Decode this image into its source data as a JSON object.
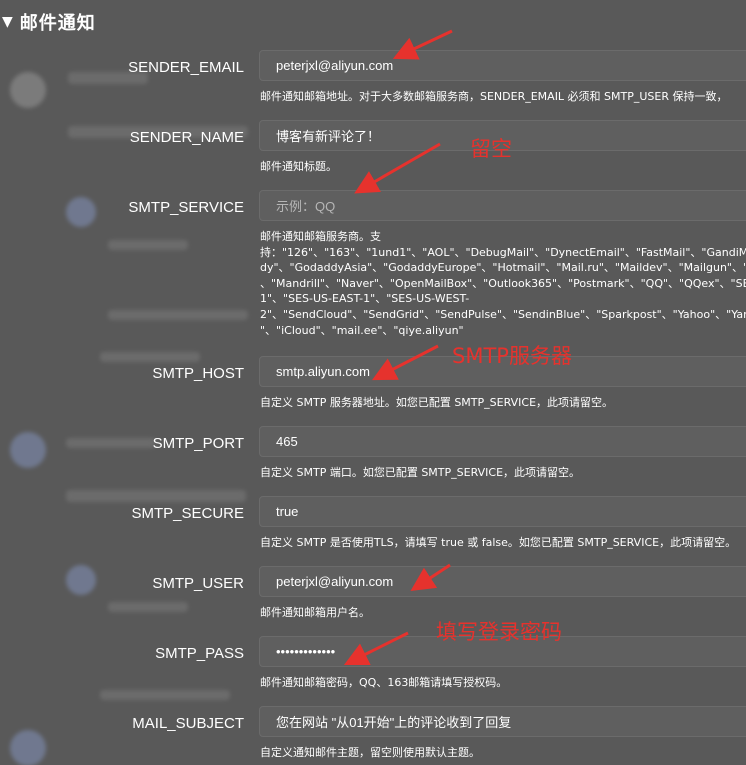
{
  "section": {
    "title": "邮件通知",
    "toggle_icon": "triangle-down-icon"
  },
  "fields": [
    {
      "id": "sender_email",
      "label": "SENDER_EMAIL",
      "value": "peterjxl@aliyun.com",
      "help": "邮件通知邮箱地址。对于大多数邮箱服务商，SENDER_EMAIL 必须和 SMTP_USER 保持一致，"
    },
    {
      "id": "sender_name",
      "label": "SENDER_NAME",
      "value": "博客有新评论了！",
      "help": "邮件通知标题。"
    },
    {
      "id": "smtp_service",
      "label": "SMTP_SERVICE",
      "placeholder": "示例：QQ",
      "help_lines": [
        "邮件通知邮箱服务商。支",
        "持：\"126\"、\"163\"、\"1und1\"、\"AOL\"、\"DebugMail\"、\"DynectEmail\"、\"FastMail\"、\"GandiMa",
        "dy\"、\"GodaddyAsia\"、\"GodaddyEurope\"、\"Hotmail\"、\"Mail.ru\"、\"Maildev\"、\"Mailgun\"、\"M",
        "、\"Mandrill\"、\"Naver\"、\"OpenMailBox\"、\"Outlook365\"、\"Postmark\"、\"QQ\"、\"QQex\"、\"SES",
        "1\"、\"SES-US-EAST-1\"、\"SES-US-WEST-",
        "2\"、\"SendCloud\"、\"SendGrid\"、\"SendPulse\"、\"SendinBlue\"、\"Sparkpost\"、\"Yahoo\"、\"Yand",
        "\"、\"iCloud\"、\"mail.ee\"、\"qiye.aliyun\""
      ]
    },
    {
      "id": "smtp_host",
      "label": "SMTP_HOST",
      "value": "smtp.aliyun.com",
      "help": "自定义 SMTP 服务器地址。如您已配置 SMTP_SERVICE，此项请留空。"
    },
    {
      "id": "smtp_port",
      "label": "SMTP_PORT",
      "value": "465",
      "help": "自定义 SMTP 端口。如您已配置 SMTP_SERVICE，此项请留空。"
    },
    {
      "id": "smtp_secure",
      "label": "SMTP_SECURE",
      "value": "true",
      "help": "自定义 SMTP 是否使用TLS，请填写 true 或 false。如您已配置 SMTP_SERVICE，此项请留空。"
    },
    {
      "id": "smtp_user",
      "label": "SMTP_USER",
      "value": "peterjxl@aliyun.com",
      "help": "邮件通知邮箱用户名。"
    },
    {
      "id": "smtp_pass",
      "label": "SMTP_PASS",
      "value": "•••••••••••••",
      "help": "邮件通知邮箱密码，QQ、163邮箱请填写授权码。"
    },
    {
      "id": "mail_subject",
      "label": "MAIL_SUBJECT",
      "value": "您在网站 \"从01开始\"上的评论收到了回复",
      "help": "自定义通知邮件主题，留空则使用默认主题。"
    }
  ],
  "annotations": {
    "color": "#e6322d",
    "leave_blank": "留空",
    "smtp_server": "SMTP服务器",
    "fill_password": "填写登录密码"
  }
}
